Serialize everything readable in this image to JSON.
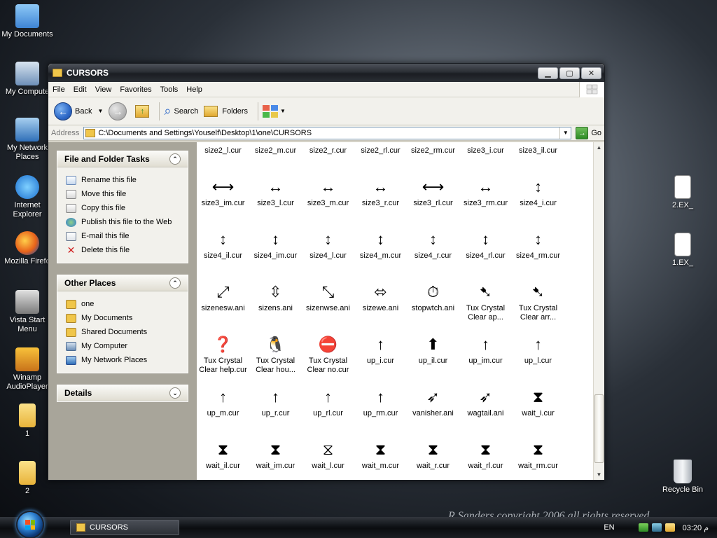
{
  "desktop": {
    "icons": [
      {
        "label": "My Documents",
        "icon": "my-documents-icon"
      },
      {
        "label": "My Compute",
        "icon": "my-computer-icon"
      },
      {
        "label": "My Network Places",
        "icon": "network-places-icon"
      },
      {
        "label": "Internet Explorer",
        "icon": "internet-explorer-icon"
      },
      {
        "label": "Mozilla Firefo",
        "icon": "firefox-icon"
      },
      {
        "label": "Vista Start Menu",
        "icon": "vista-start-menu-icon"
      },
      {
        "label": "Winamp AudioPlayer",
        "icon": "winamp-icon"
      },
      {
        "label": "1",
        "icon": "folder-icon"
      },
      {
        "label": "2",
        "icon": "folder-icon"
      },
      {
        "label": "2.EX_",
        "icon": "file-icon"
      },
      {
        "label": "1.EX_",
        "icon": "file-icon"
      },
      {
        "label": "Recycle Bin",
        "icon": "recycle-bin-icon"
      }
    ],
    "wallpaper_text": "R Sanders copyright 2006 all rights reserved"
  },
  "window": {
    "title": "CURSORS",
    "menu": [
      "File",
      "Edit",
      "View",
      "Favorites",
      "Tools",
      "Help"
    ],
    "toolbar": {
      "back": "Back",
      "search": "Search",
      "folders": "Folders"
    },
    "address": {
      "label": "Address",
      "path": "C:\\Documents and Settings\\Youself\\Desktop\\1\\one\\CURSORS",
      "go": "Go"
    }
  },
  "tasks": {
    "file_folder": {
      "title": "File and Folder Tasks",
      "items": [
        "Rename this file",
        "Move this file",
        "Copy this file",
        "Publish this file to the Web",
        "E-mail this file",
        "Delete this file"
      ]
    },
    "other_places": {
      "title": "Other Places",
      "items": [
        "one",
        "My Documents",
        "Shared Documents",
        "My Computer",
        "My Network Places"
      ]
    },
    "details": {
      "title": "Details"
    }
  },
  "files": [
    [
      {
        "name": "size2_l.cur",
        "glyph": ""
      },
      {
        "name": "size2_m.cur",
        "glyph": ""
      },
      {
        "name": "size2_r.cur",
        "glyph": ""
      },
      {
        "name": "size2_rl.cur",
        "glyph": ""
      },
      {
        "name": "size2_rm.cur",
        "glyph": ""
      },
      {
        "name": "size3_i.cur",
        "glyph": ""
      },
      {
        "name": "size3_il.cur",
        "glyph": ""
      }
    ],
    [
      {
        "name": "size3_im.cur",
        "glyph": "⟷"
      },
      {
        "name": "size3_l.cur",
        "glyph": "↔"
      },
      {
        "name": "size3_m.cur",
        "glyph": "↔"
      },
      {
        "name": "size3_r.cur",
        "glyph": "↔"
      },
      {
        "name": "size3_rl.cur",
        "glyph": "⟷"
      },
      {
        "name": "size3_rm.cur",
        "glyph": "↔"
      },
      {
        "name": "size4_i.cur",
        "glyph": "↕"
      }
    ],
    [
      {
        "name": "size4_il.cur",
        "glyph": "↕"
      },
      {
        "name": "size4_im.cur",
        "glyph": "↕"
      },
      {
        "name": "size4_l.cur",
        "glyph": "↕"
      },
      {
        "name": "size4_m.cur",
        "glyph": "↕"
      },
      {
        "name": "size4_r.cur",
        "glyph": "↕"
      },
      {
        "name": "size4_rl.cur",
        "glyph": "↕"
      },
      {
        "name": "size4_rm.cur",
        "glyph": "↕"
      }
    ],
    [
      {
        "name": "sizenesw.ani",
        "glyph": "⤢"
      },
      {
        "name": "sizens.ani",
        "glyph": "⇳"
      },
      {
        "name": "sizenwse.ani",
        "glyph": "⤡"
      },
      {
        "name": "sizewe.ani",
        "glyph": "⬄"
      },
      {
        "name": "stopwtch.ani",
        "glyph": "⏱"
      },
      {
        "name": "Tux Crystal Clear ap...",
        "glyph": "➷"
      },
      {
        "name": "Tux Crystal Clear arr...",
        "glyph": "➷"
      }
    ],
    [
      {
        "name": "Tux Crystal Clear help.cur",
        "glyph": "❓"
      },
      {
        "name": "Tux Crystal Clear hou...",
        "glyph": "🐧"
      },
      {
        "name": "Tux Crystal Clear no.cur",
        "glyph": "⛔"
      },
      {
        "name": "up_i.cur",
        "glyph": "↑"
      },
      {
        "name": "up_il.cur",
        "glyph": "⬆"
      },
      {
        "name": "up_im.cur",
        "glyph": "↑"
      },
      {
        "name": "up_l.cur",
        "glyph": "↑"
      }
    ],
    [
      {
        "name": "up_m.cur",
        "glyph": "↑"
      },
      {
        "name": "up_r.cur",
        "glyph": "↑"
      },
      {
        "name": "up_rl.cur",
        "glyph": "↑"
      },
      {
        "name": "up_rm.cur",
        "glyph": "↑"
      },
      {
        "name": "vanisher.ani",
        "glyph": "➶"
      },
      {
        "name": "wagtail.ani",
        "glyph": "➶"
      },
      {
        "name": "wait_i.cur",
        "glyph": "⧗"
      }
    ],
    [
      {
        "name": "wait_il.cur",
        "glyph": "⧗"
      },
      {
        "name": "wait_im.cur",
        "glyph": "⧗"
      },
      {
        "name": "wait_l.cur",
        "glyph": "⧖"
      },
      {
        "name": "wait_m.cur",
        "glyph": "⧗"
      },
      {
        "name": "wait_r.cur",
        "glyph": "⧗"
      },
      {
        "name": "wait_rl.cur",
        "glyph": "⧗"
      },
      {
        "name": "wait_rm.cur",
        "glyph": "⧗"
      }
    ]
  ],
  "taskbar": {
    "window_button": "CURSORS",
    "language": "EN",
    "clock": "03:20 م"
  },
  "colors": {
    "accent": "#2e69c8",
    "folder": "#f0c64a"
  }
}
